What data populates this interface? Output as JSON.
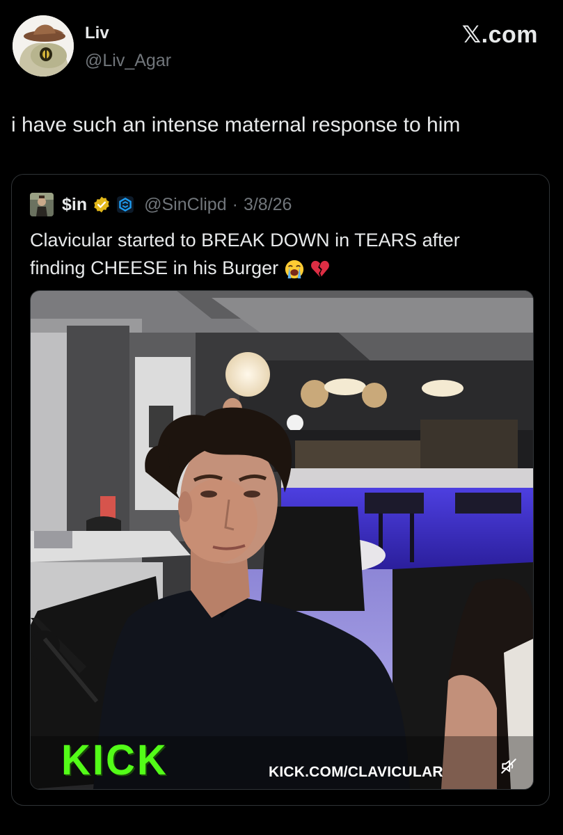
{
  "author": {
    "name": "Liv",
    "handle": "@Liv_Agar"
  },
  "brand": "𝕏.com",
  "tweet_text": "i have such an intense maternal response to him",
  "quoted": {
    "name": "$in",
    "handle": "@SinClipd",
    "separator": "·",
    "date": "3/8/26",
    "text": "Clavicular started to BREAK DOWN in TEARS after finding CHEESE in his Burger",
    "emojis": [
      "loudly-crying-face-emoji",
      "broken-heart-emoji"
    ]
  },
  "media": {
    "logo_text": "KICK",
    "url_text": "KICK.COM/CLAVICULAR",
    "muted": true
  },
  "colors": {
    "background": "#000000",
    "text": "#e7e9ea",
    "secondary": "#71767b",
    "border": "#2f3336",
    "kick_green": "#53fc18",
    "verified_gold": "#e2b719",
    "affiliate_blue": "#1d9bf0"
  }
}
